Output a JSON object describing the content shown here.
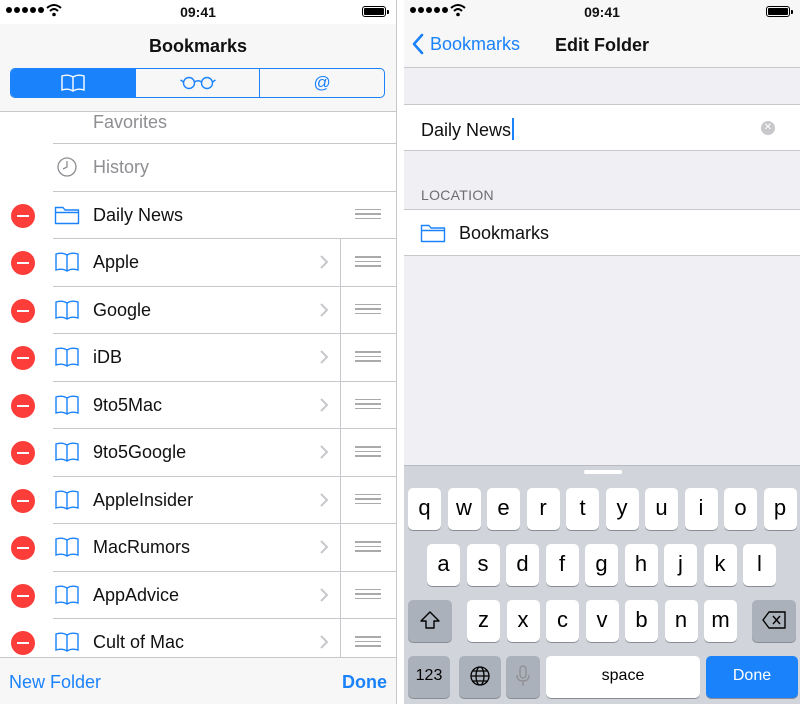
{
  "status_bar": {
    "time": "09:41"
  },
  "left": {
    "title": "Bookmarks",
    "segments": [
      "bookmarks-book-icon",
      "reading-list-glasses-icon",
      "shared-links-at-icon"
    ],
    "segment_at_glyph": "@",
    "items": [
      {
        "label": "Favorites",
        "type": "star",
        "editable": false
      },
      {
        "label": "History",
        "type": "clock",
        "editable": false
      },
      {
        "label": "Daily News",
        "type": "folder",
        "editable": true
      },
      {
        "label": "Apple",
        "type": "bookmark",
        "editable": true
      },
      {
        "label": "Google",
        "type": "bookmark",
        "editable": true
      },
      {
        "label": "iDB",
        "type": "bookmark",
        "editable": true
      },
      {
        "label": "9to5Mac",
        "type": "bookmark",
        "editable": true
      },
      {
        "label": "9to5Google",
        "type": "bookmark",
        "editable": true
      },
      {
        "label": "AppleInsider",
        "type": "bookmark",
        "editable": true
      },
      {
        "label": "MacRumors",
        "type": "bookmark",
        "editable": true
      },
      {
        "label": "AppAdvice",
        "type": "bookmark",
        "editable": true
      },
      {
        "label": "Cult of Mac",
        "type": "bookmark",
        "editable": true
      }
    ],
    "toolbar": {
      "new_folder": "New Folder",
      "done": "Done"
    }
  },
  "right": {
    "back_label": "Bookmarks",
    "title": "Edit Folder",
    "name_value": "Daily News",
    "location_header": "LOCATION",
    "location_value": "Bookmarks",
    "keyboard": {
      "row1": [
        "q",
        "w",
        "e",
        "r",
        "t",
        "y",
        "u",
        "i",
        "o",
        "p"
      ],
      "row2": [
        "a",
        "s",
        "d",
        "f",
        "g",
        "h",
        "j",
        "k",
        "l"
      ],
      "row3": [
        "z",
        "x",
        "c",
        "v",
        "b",
        "n",
        "m"
      ],
      "numbers_key": "123",
      "space_key": "space",
      "done_key": "Done"
    }
  },
  "colors": {
    "accent": "#1a82fb",
    "delete": "#fc3d39",
    "separator": "#c8c7cc",
    "grouped_bg": "#efeff4",
    "keyboard_bg": "#d1d5db"
  }
}
